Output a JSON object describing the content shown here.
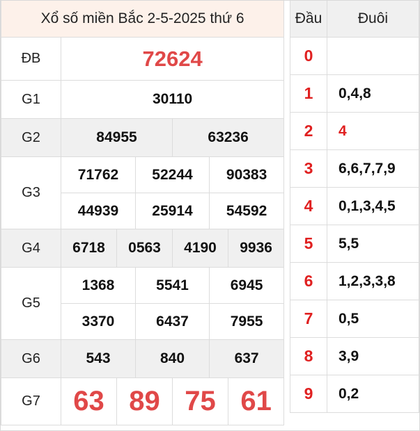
{
  "title": "Xổ số miền Bắc 2-5-2025 thứ 6",
  "prizes": {
    "db": {
      "label": "ĐB",
      "numbers": [
        "72624"
      ]
    },
    "g1": {
      "label": "G1",
      "numbers": [
        "30110"
      ]
    },
    "g2": {
      "label": "G2",
      "numbers": [
        "84955",
        "63236"
      ]
    },
    "g3": {
      "label": "G3",
      "numbers": [
        "71762",
        "52244",
        "90383",
        "44939",
        "25914",
        "54592"
      ]
    },
    "g4": {
      "label": "G4",
      "numbers": [
        "6718",
        "0563",
        "4190",
        "9936"
      ]
    },
    "g5": {
      "label": "G5",
      "numbers": [
        "1368",
        "5541",
        "6945",
        "3370",
        "6437",
        "7955"
      ]
    },
    "g6": {
      "label": "G6",
      "numbers": [
        "543",
        "840",
        "637"
      ]
    },
    "g7": {
      "label": "G7",
      "numbers": [
        "63",
        "89",
        "75",
        "61"
      ]
    }
  },
  "headtail": {
    "head_label": "Đầu",
    "tail_label": "Đuôi",
    "rows": [
      {
        "head": "0",
        "tail": ""
      },
      {
        "head": "1",
        "tail": "0,4,8"
      },
      {
        "head": "2",
        "tail": "4"
      },
      {
        "head": "3",
        "tail": "6,6,7,7,9"
      },
      {
        "head": "4",
        "tail": "0,1,3,4,5"
      },
      {
        "head": "5",
        "tail": "5,5"
      },
      {
        "head": "6",
        "tail": "1,2,3,3,8"
      },
      {
        "head": "7",
        "tail": "0,5"
      },
      {
        "head": "8",
        "tail": "3,9"
      },
      {
        "head": "9",
        "tail": "0,2"
      }
    ]
  },
  "colors": {
    "accent_red": "#e04848",
    "title_bg": "#fdf1ea",
    "shade_bg": "#f0f0f0"
  }
}
